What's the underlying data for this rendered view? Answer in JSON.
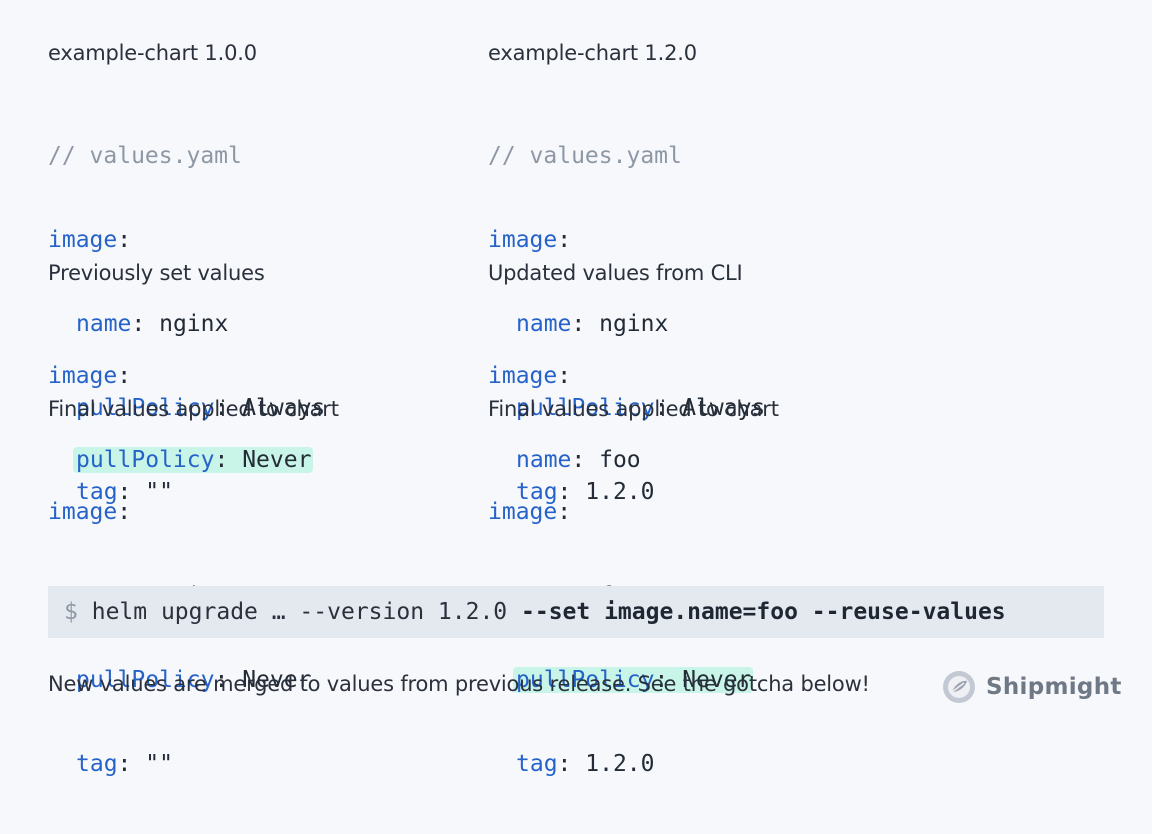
{
  "left": {
    "title": "example-chart 1.0.0",
    "values": {
      "comment": "// values.yaml",
      "image_key": "image",
      "name_key": "name",
      "name_val": "nginx",
      "pull_key": "pullPolicy",
      "pull_val": "Always",
      "tag_key": "tag",
      "tag_val": "\"\""
    },
    "prev_title": "Previously set values",
    "prev": {
      "image_key": "image",
      "pull_key": "pullPolicy",
      "pull_val": "Never"
    },
    "final_title": "Final values applied to chart",
    "final": {
      "image_key": "image",
      "name_key": "name",
      "name_val": "nginx",
      "pull_key": "pullPolicy",
      "pull_val": "Never",
      "tag_key": "tag",
      "tag_val": "\"\""
    }
  },
  "right": {
    "title": "example-chart 1.2.0",
    "values": {
      "comment": "// values.yaml",
      "image_key": "image",
      "name_key": "name",
      "name_val": "nginx",
      "pull_key": "pullPolicy",
      "pull_val": "Always",
      "tag_key": "tag",
      "tag_val": "1.2.0"
    },
    "cli_title": "Updated values from CLI",
    "cli": {
      "image_key": "image",
      "name_key": "name",
      "name_val": "foo"
    },
    "final_title": "Final values applied to chart",
    "final": {
      "image_key": "image",
      "name_key": "name",
      "name_val": "foo",
      "pull_key": "pullPolicy",
      "pull_val": "Never",
      "tag_key": "tag",
      "tag_val": "1.2.0"
    }
  },
  "command": {
    "prompt": "$",
    "plain": "helm upgrade … --version 1.2.0",
    "bold": "--set image.name=foo --reuse-values"
  },
  "footer": {
    "text": "New values are merged to values from previous release. See the gotcha below!"
  },
  "brand": {
    "name": "Shipmight"
  },
  "colors": {
    "key": "#2563c9",
    "comment": "#8e98a5",
    "highlight": "#c9f5e8",
    "command_bg": "#e4e8ef",
    "background": "#f7f8fb"
  }
}
